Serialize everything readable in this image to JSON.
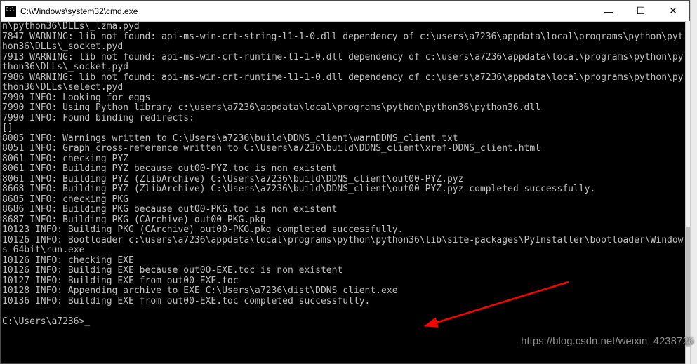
{
  "title": "C:\\Windows\\system32\\cmd.exe",
  "buttons": {
    "min": "—",
    "max": "☐",
    "close": "✕"
  },
  "watermark": "https://blog.csdn.net/weixin_4238726",
  "prompt": {
    "text": "C:\\Users\\a7236>",
    "cursor": "_"
  },
  "lines": [
    "n\\python36\\DLLs\\_lzma.pyd",
    "7847 WARNING: lib not found: api-ms-win-crt-string-l1-1-0.dll dependency of c:\\users\\a7236\\appdata\\local\\programs\\python\\python36\\DLLs\\_socket.pyd",
    "7913 WARNING: lib not found: api-ms-win-crt-runtime-l1-1-0.dll dependency of c:\\users\\a7236\\appdata\\local\\programs\\python\\python36\\DLLs\\_socket.pyd",
    "7986 WARNING: lib not found: api-ms-win-crt-runtime-l1-1-0.dll dependency of c:\\users\\a7236\\appdata\\local\\programs\\python\\python36\\DLLs\\select.pyd",
    "7990 INFO: Looking for eggs",
    "7990 INFO: Using Python library c:\\users\\a7236\\appdata\\local\\programs\\python\\python36\\python36.dll",
    "7990 INFO: Found binding redirects:",
    "[]",
    "8005 INFO: Warnings written to C:\\Users\\a7236\\build\\DDNS_client\\warnDDNS_client.txt",
    "8051 INFO: Graph cross-reference written to C:\\Users\\a7236\\build\\DDNS_client\\xref-DDNS_client.html",
    "8061 INFO: checking PYZ",
    "8061 INFO: Building PYZ because out00-PYZ.toc is non existent",
    "8061 INFO: Building PYZ (ZlibArchive) C:\\Users\\a7236\\build\\DDNS_client\\out00-PYZ.pyz",
    "8668 INFO: Building PYZ (ZlibArchive) C:\\Users\\a7236\\build\\DDNS_client\\out00-PYZ.pyz completed successfully.",
    "8685 INFO: checking PKG",
    "8686 INFO: Building PKG because out00-PKG.toc is non existent",
    "8687 INFO: Building PKG (CArchive) out00-PKG.pkg",
    "10123 INFO: Building PKG (CArchive) out00-PKG.pkg completed successfully.",
    "10126 INFO: Bootloader c:\\users\\a7236\\appdata\\local\\programs\\python\\python36\\lib\\site-packages\\PyInstaller\\bootloader\\Windows-64bit\\run.exe",
    "10126 INFO: checking EXE",
    "10126 INFO: Building EXE because out00-EXE.toc is non existent",
    "10127 INFO: Building EXE from out00-EXE.toc",
    "10128 INFO: Appending archive to EXE C:\\Users\\a7236\\dist\\DDNS_client.exe",
    "10136 INFO: Building EXE from out00-EXE.toc completed successfully.",
    ""
  ],
  "arrow_color": "#ff0000"
}
